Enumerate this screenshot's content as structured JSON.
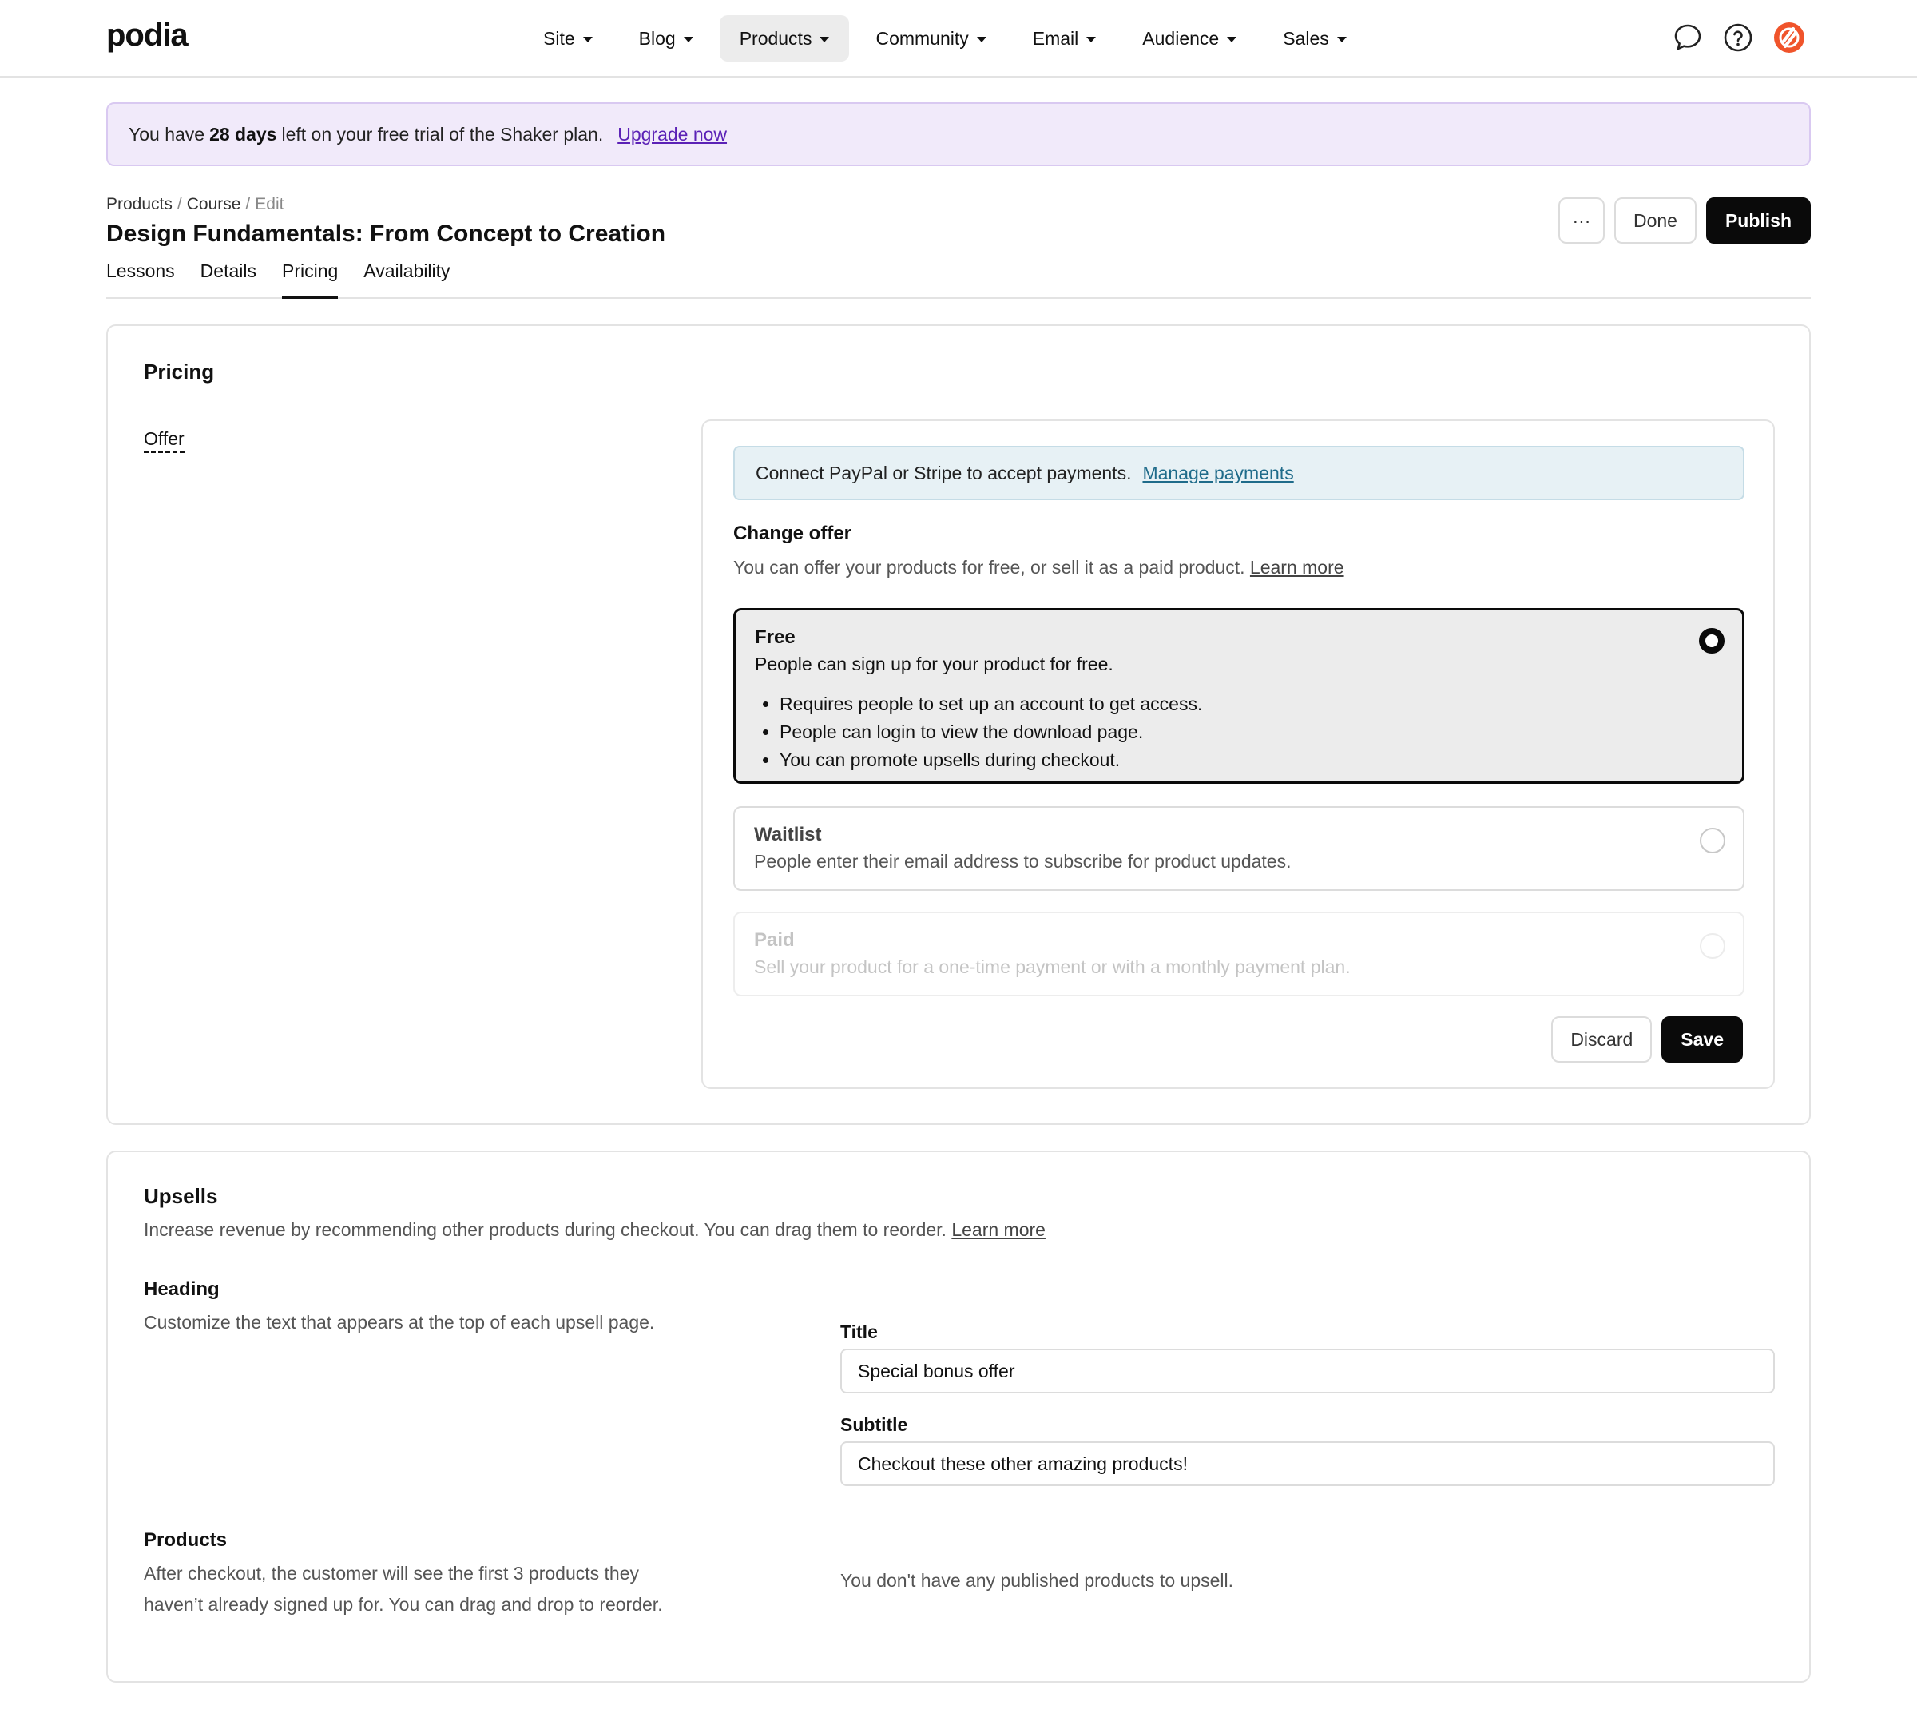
{
  "brand": {
    "logo": "podia"
  },
  "nav": {
    "items": [
      {
        "label": "Site"
      },
      {
        "label": "Blog"
      },
      {
        "label": "Products"
      },
      {
        "label": "Community"
      },
      {
        "label": "Email"
      },
      {
        "label": "Audience"
      },
      {
        "label": "Sales"
      }
    ],
    "active": "Products"
  },
  "trial": {
    "prefix": "You have",
    "days": "28 days",
    "suffix": "left on your free trial of the Shaker plan.",
    "link": "Upgrade now"
  },
  "breadcrumb": {
    "products": "Products",
    "course": "Course",
    "edit": "Edit",
    "sep": "/"
  },
  "page": {
    "title": "Design Fundamentals: From Concept to Creation"
  },
  "header_actions": {
    "more": "···",
    "done": "Done",
    "publish": "Publish"
  },
  "tabs": [
    {
      "label": "Lessons"
    },
    {
      "label": "Details"
    },
    {
      "label": "Pricing"
    },
    {
      "label": "Availability"
    }
  ],
  "active_tab": "Pricing",
  "pricing": {
    "title": "Pricing",
    "offer_label": "Offer",
    "payment_note": "Connect PayPal or Stripe to accept payments.",
    "payment_link": "Manage payments",
    "change_title": "Change offer",
    "change_desc": "You can offer your products for free, or sell it as a paid product.",
    "learn_more": "Learn more",
    "options": {
      "free": {
        "title": "Free",
        "desc": "People can sign up for your product for free.",
        "bullets": [
          "Requires people to set up an account to get access.",
          "People can login to view the download page.",
          "You can promote upsells during checkout."
        ]
      },
      "waitlist": {
        "title": "Waitlist",
        "desc": "People enter their email address to subscribe for product updates."
      },
      "paid": {
        "title": "Paid",
        "desc": "Sell your product for a one-time payment or with a monthly payment plan."
      }
    },
    "selected": "Free",
    "discard": "Discard",
    "save": "Save"
  },
  "upsells": {
    "title": "Upsells",
    "desc": "Increase revenue by recommending other products during checkout. You can drag them to reorder.",
    "learn_more": "Learn more",
    "heading": {
      "title": "Heading",
      "desc": "Customize the text that appears at the top of each upsell page."
    },
    "fields": {
      "title_label": "Title",
      "title_value": "Special bonus offer",
      "subtitle_label": "Subtitle",
      "subtitle_value": "Checkout these other amazing products!"
    },
    "products": {
      "title": "Products",
      "desc": "After checkout, the customer will see the first 3 products they haven’t already signed up for. You can drag and drop to reorder.",
      "empty": "You don't have any published products to upsell."
    }
  },
  "colors": {
    "accent_dark": "#0a0a0a",
    "trial_bg": "#f1eafa",
    "trial_link": "#5b21b6",
    "payment_bg": "#e7f1f5",
    "payment_link": "#1f6b8a",
    "avatar_orange": "#f0542b"
  },
  "icons": {
    "chat": "chat-bubble-icon",
    "help": "help-circle-icon",
    "avatar": "user-avatar-icon"
  }
}
